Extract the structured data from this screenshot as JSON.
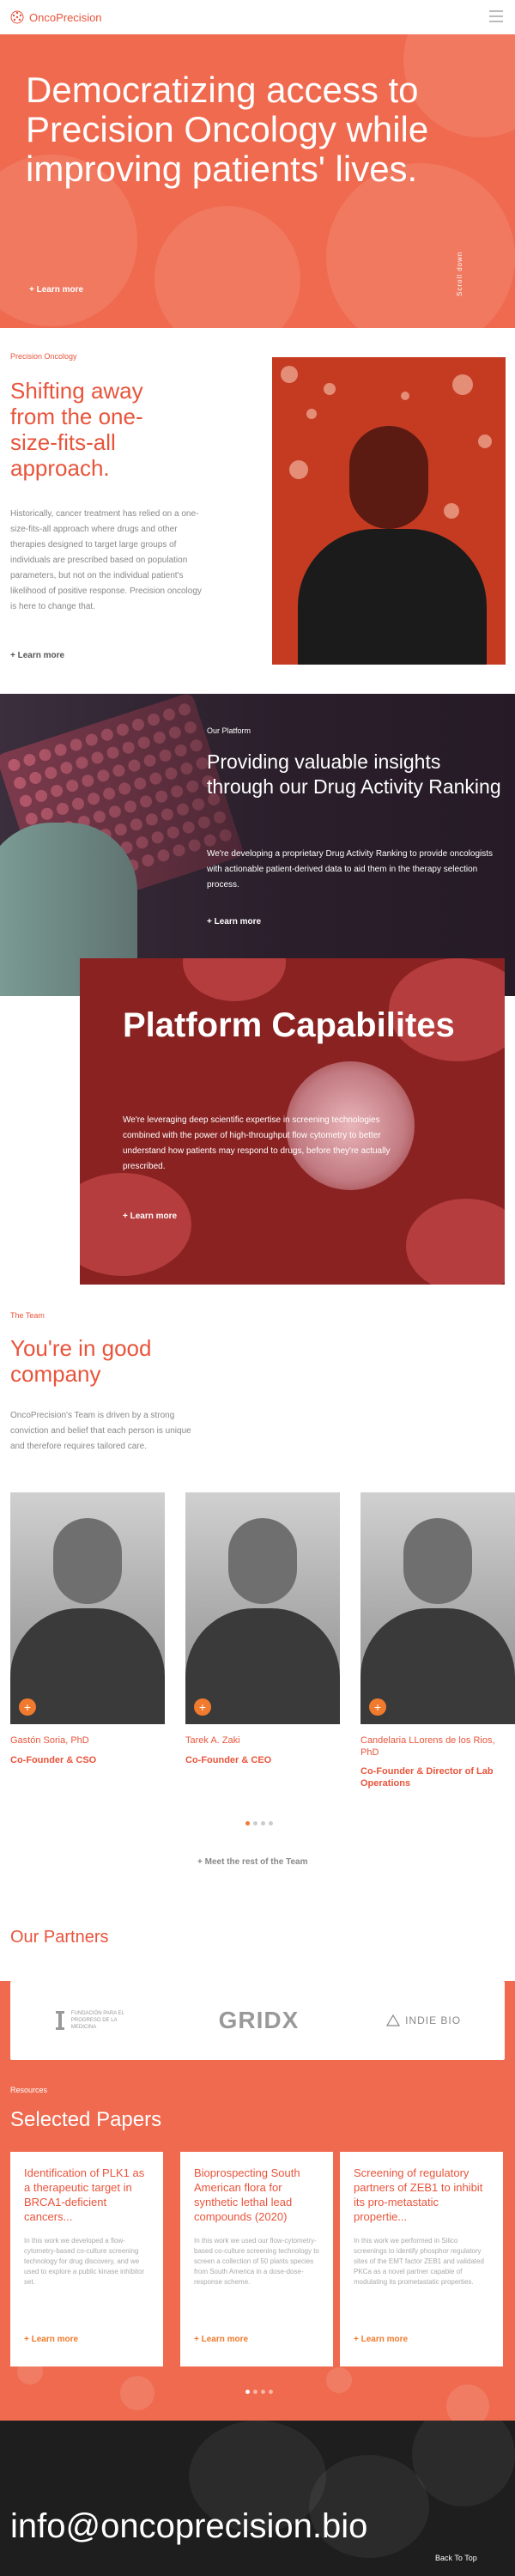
{
  "header": {
    "logo_text": "OncoPrecision",
    "menu_icon": "hamburger-icon"
  },
  "hero": {
    "title": "Democratizing access to Precision Oncology while improving patients' lives.",
    "learn_more": "+ Learn more",
    "scroll_down": "Scroll down"
  },
  "shifting": {
    "eyebrow": "Precision Oncology",
    "heading": "Shifting away from the one-size-fits-all approach.",
    "body": "Historically, cancer treatment has relied on a one-size-fits-all approach where drugs and other therapies designed to target large groups of individuals are prescribed based on population parameters, but not on the individual patient's likelihood of positive response. Precision oncology is here to change that.",
    "learn_more": "+ Learn more"
  },
  "drug": {
    "eyebrow": "Our Platform",
    "heading": "Providing valuable insights through our Drug Activity Ranking",
    "body": "We're developing a proprietary Drug Activity Ranking to provide oncologists with actionable patient-derived data to aid them in the therapy selection process.",
    "learn_more": "+ Learn more"
  },
  "platform": {
    "heading": "Platform Capabilites",
    "body": "We're leveraging deep scientific expertise in screening technologies combined with the power of high-throughput flow cytometry to better understand how patients may respond to drugs, before they're actually prescribed.",
    "learn_more": "+ Learn more"
  },
  "team": {
    "eyebrow": "The Team",
    "heading": "You're in good company",
    "body": "OncoPrecision's Team is driven by a strong conviction and belief that each person is unique and therefore requires tailored care.",
    "members": [
      {
        "name": "Gastón Soria, PhD",
        "role": "Co-Founder & CSO"
      },
      {
        "name": "Tarek A. Zaki",
        "role": "Co-Founder & CEO"
      },
      {
        "name": "Candelaria LLorens de los Rios, PhD",
        "role": "Co-Founder & Director of Lab Operations"
      }
    ],
    "meet_rest": "+ Meet the rest of the Team"
  },
  "partners": {
    "heading": "Our Partners",
    "logos": [
      "FUNDACIÓN PARA EL PROGRESO DE LA MEDICINA",
      "GRIDX",
      "INDIE BIO"
    ]
  },
  "papers": {
    "eyebrow": "Resources",
    "heading": "Selected Papers",
    "items": [
      {
        "title": "Identification of PLK1 as a therapeutic target in BRCA1-deficient cancers...",
        "body": "In this work we developed a flow-cytometry-based co-culture screening technology for drug discovery, and we used to explore a public kinase inhibitor set.",
        "link": "+ Learn more"
      },
      {
        "title": "Bioprospecting South American flora for synthetic lethal lead compounds (2020)",
        "body": "In this work we used our flow-cytometry-based co-culture screening technology to screen a collection of 50 plants species from South America in a dose-dose-response scheme.",
        "link": "+ Learn more"
      },
      {
        "title": "Screening of regulatory partners of ZEB1 to inhibit its pro-metastatic propertie...",
        "body": "In this work we performed in Silico screenings to identify phosphor regulatory sites of the EMT factor ZEB1 and validated PKCa as a novel partner capable of modulating its prometastatic properties.",
        "link": "+ Learn more"
      }
    ]
  },
  "footer": {
    "email": "info@oncoprecision.bio",
    "back_to_top": "Back To Top"
  },
  "colors": {
    "brand": "#e8543b",
    "accent": "#f07a2d",
    "hero_bg": "#ef6a4f"
  }
}
